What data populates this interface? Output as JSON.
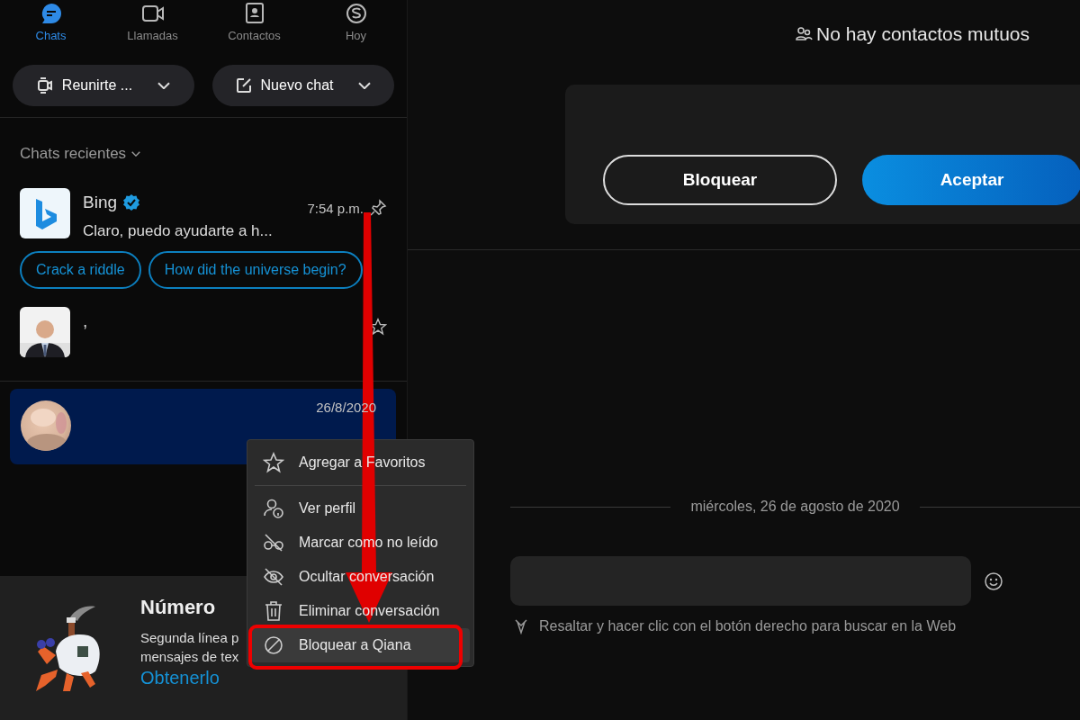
{
  "nav_tabs": [
    {
      "label": "Chats",
      "kind": "chat",
      "selected": true
    },
    {
      "label": "Llamadas",
      "kind": "video",
      "selected": false
    },
    {
      "label": "Contactos",
      "kind": "contacts",
      "selected": false
    },
    {
      "label": "Hoy",
      "kind": "today",
      "selected": false
    }
  ],
  "actions": [
    {
      "label": "Reunirte ...",
      "kind": "meet"
    },
    {
      "label": "Nuevo chat",
      "kind": "compose"
    }
  ],
  "recent_header": "Chats recientes",
  "chats": [
    {
      "name": "Bing",
      "verified": true,
      "time": "7:54 p.m.",
      "preview": "Claro, puedo ayudarte a h...",
      "kind": "bing",
      "pinned": true,
      "selected": false,
      "suggestions": [
        "Crack a riddle",
        "How did the universe begin?"
      ]
    },
    {
      "name": ",",
      "verified": false,
      "pinned": false,
      "selected": false
    },
    {
      "time": "26/8/2020",
      "verified": false,
      "kind": "blurred",
      "selected": true
    }
  ],
  "promo": {
    "title": "Número",
    "lines": [
      "Segunda línea p",
      "mensajes de tex"
    ],
    "link": "Obtenerlo"
  },
  "context_menu": {
    "groups": [
      [
        {
          "label": "Agregar a Favoritos",
          "kind": "star",
          "selected": false
        }
      ],
      [
        {
          "label": "Ver perfil",
          "kind": "profile",
          "selected": false
        },
        {
          "label": "Marcar como no leído",
          "kind": "unread",
          "selected": false
        },
        {
          "label": "Ocultar conversación",
          "kind": "hide",
          "selected": false
        },
        {
          "label": "Eliminar conversación",
          "kind": "delete",
          "selected": false
        },
        {
          "label": "Bloquear a Qiana",
          "kind": "block",
          "selected": true
        }
      ]
    ]
  },
  "mutual_contacts": "No hay contactos mutuos",
  "request_buttons": [
    {
      "label": "Bloquear",
      "kind": "outline"
    },
    {
      "label": "Aceptar",
      "kind": "primary"
    }
  ],
  "date_divider": "miércoles, 26 de agosto de 2020",
  "hint": "Resaltar y hacer clic con el botón derecho para buscar en la Web",
  "annotation": {
    "arrow": true,
    "highlight": true
  }
}
